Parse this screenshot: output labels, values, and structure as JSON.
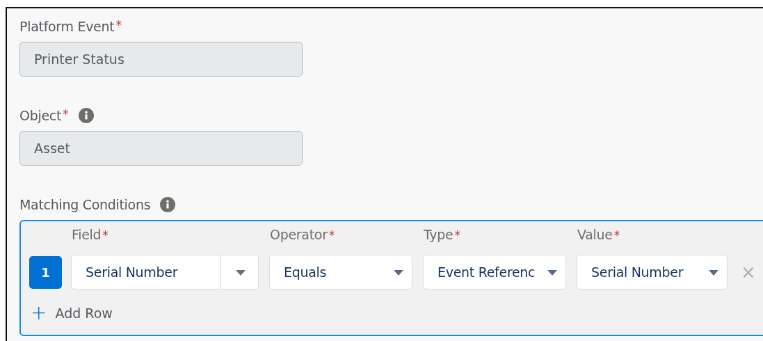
{
  "fields": [
    {
      "label": "Platform Event",
      "required_mark": "*",
      "info": false,
      "value": "Printer Status",
      "disabled": true
    },
    {
      "label": "Object",
      "required_mark": "*",
      "info": true,
      "value": "Asset",
      "disabled": true
    }
  ],
  "matching_conditions": {
    "label": "Matching Conditions",
    "info": true,
    "columns": [
      {
        "label": "Field",
        "required_mark": "*"
      },
      {
        "label": "Operator",
        "required_mark": "*"
      },
      {
        "label": "Type",
        "required_mark": "*"
      },
      {
        "label": "Value",
        "required_mark": "*"
      }
    ],
    "rows": [
      {
        "index": "1",
        "remove": "×",
        "cells": [
          {
            "kind": "lookup",
            "value": "Serial Number"
          },
          {
            "kind": "picklist",
            "value": "Equals"
          },
          {
            "kind": "picklist",
            "value": "Event Referenc"
          },
          {
            "kind": "picklist",
            "value": "Serial Number"
          }
        ]
      }
    ],
    "add_row": {
      "icon": "+",
      "label": "Add Row"
    }
  }
}
